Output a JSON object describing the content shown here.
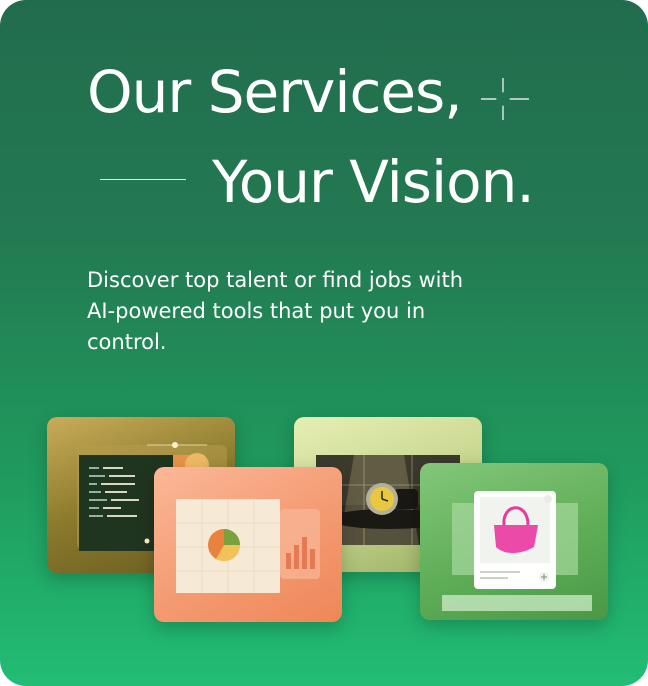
{
  "hero": {
    "headline_line1": "Our Services,",
    "headline_line2": "Your Vision.",
    "subtitle": "Discover top talent or find jobs with AI-powered tools that put you in control."
  },
  "tiles": [
    {
      "name": "code-editor-tile",
      "icon": "code-window-illustration"
    },
    {
      "name": "pie-chart-tile",
      "icon": "pie-chart-illustration"
    },
    {
      "name": "watch-photo-tile",
      "icon": "wristwatch-photo"
    },
    {
      "name": "handbag-product-tile",
      "icon": "pink-handbag-product-card"
    }
  ],
  "colors": {
    "background_top": "#216c4d",
    "background_bottom": "#22bd75",
    "text": "#ffffff",
    "tile_code": "#8a7a2c",
    "tile_chart": "#f49a72",
    "tile_watch": "#c3d48a",
    "tile_bag": "#5fae57"
  }
}
